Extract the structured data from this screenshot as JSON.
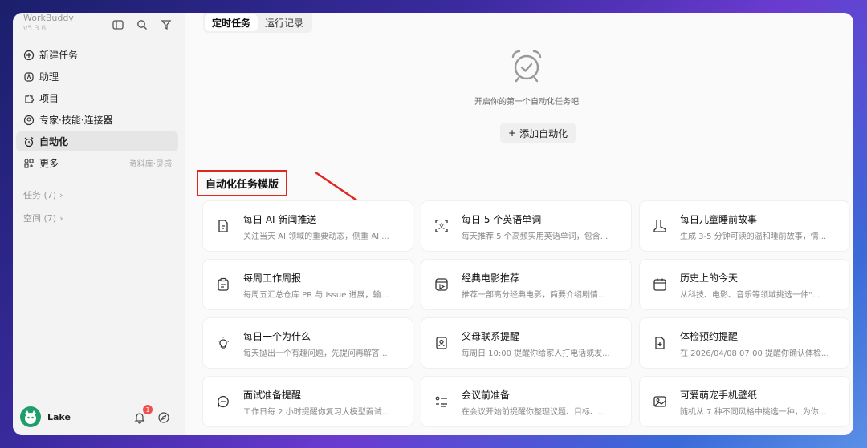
{
  "app": {
    "name": "WorkBuddy",
    "version": "v5.3.6"
  },
  "sidebar": {
    "items": [
      {
        "label": "新建任务",
        "icon": "plus-circle-icon"
      },
      {
        "label": "助理",
        "icon": "assistant-icon"
      },
      {
        "label": "项目",
        "icon": "puzzle-icon"
      },
      {
        "label": "专家·技能·连接器",
        "icon": "expert-icon"
      },
      {
        "label": "自动化",
        "icon": "alarm-clock-icon",
        "active": true
      },
      {
        "label": "更多",
        "icon": "apps-icon",
        "side": "资料库·灵感"
      }
    ],
    "groups": [
      {
        "label": "任务 (7)"
      },
      {
        "label": "空间 (7)"
      }
    ],
    "user": {
      "name": "Lake",
      "notifications": "1"
    }
  },
  "main": {
    "tabs": [
      {
        "label": "定时任务",
        "active": true
      },
      {
        "label": "运行记录"
      }
    ],
    "empty_text": "开启你的第一个自动化任务吧",
    "add_label": "添加自动化",
    "section_title": "自动化任务模版",
    "cards": [
      {
        "title": "每日 AI 新闻推送",
        "desc": "关注当天 AI 领域的重要动态，侧重 AI ...",
        "icon": "news-icon"
      },
      {
        "title": "每日 5 个英语单词",
        "desc": "每天推荐 5 个高频实用英语单词，包含...",
        "icon": "translate-icon"
      },
      {
        "title": "每日儿童睡前故事",
        "desc": "生成 3-5 分钟可读的温和睡前故事，情...",
        "icon": "boot-icon"
      },
      {
        "title": "每周工作周报",
        "desc": "每周五汇总仓库 PR 与 Issue 进展，输...",
        "icon": "clipboard-icon"
      },
      {
        "title": "经典电影推荐",
        "desc": "推荐一部高分经典电影，简要介绍剧情...",
        "icon": "film-icon"
      },
      {
        "title": "历史上的今天",
        "desc": "从科技、电影、音乐等领域挑选一件\"...",
        "icon": "calendar-icon"
      },
      {
        "title": "每日一个为什么",
        "desc": "每天抛出一个有趣问题，先提问再解答...",
        "icon": "lightbulb-icon"
      },
      {
        "title": "父母联系提醒",
        "desc": "每周日 10:00 提醒你给家人打电话或发...",
        "icon": "contact-icon"
      },
      {
        "title": "体检预约提醒",
        "desc": "在 2026/04/08 07:00 提醒你确认体检...",
        "icon": "health-icon"
      },
      {
        "title": "面试准备提醒",
        "desc": "工作日每 2 小时提醒你复习大模型面试...",
        "icon": "chat-icon"
      },
      {
        "title": "会议前准备",
        "desc": "在会议开始前提醒你整理议题、目标、...",
        "icon": "checklist-icon"
      },
      {
        "title": "可爱萌宠手机壁纸",
        "desc": "随机从 7 种不同风格中挑选一种，为你...",
        "icon": "image-icon"
      }
    ]
  }
}
